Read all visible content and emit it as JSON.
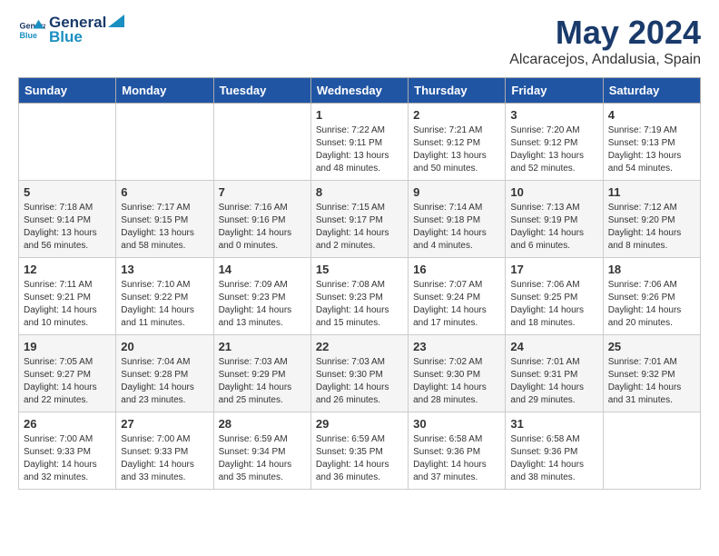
{
  "header": {
    "logo_line1": "General",
    "logo_line2": "Blue",
    "month_title": "May 2024",
    "location": "Alcaracejos, Andalusia, Spain"
  },
  "weekdays": [
    "Sunday",
    "Monday",
    "Tuesday",
    "Wednesday",
    "Thursday",
    "Friday",
    "Saturday"
  ],
  "weeks": [
    [
      {
        "day": "",
        "info": ""
      },
      {
        "day": "",
        "info": ""
      },
      {
        "day": "",
        "info": ""
      },
      {
        "day": "1",
        "info": "Sunrise: 7:22 AM\nSunset: 9:11 PM\nDaylight: 13 hours\nand 48 minutes."
      },
      {
        "day": "2",
        "info": "Sunrise: 7:21 AM\nSunset: 9:12 PM\nDaylight: 13 hours\nand 50 minutes."
      },
      {
        "day": "3",
        "info": "Sunrise: 7:20 AM\nSunset: 9:12 PM\nDaylight: 13 hours\nand 52 minutes."
      },
      {
        "day": "4",
        "info": "Sunrise: 7:19 AM\nSunset: 9:13 PM\nDaylight: 13 hours\nand 54 minutes."
      }
    ],
    [
      {
        "day": "5",
        "info": "Sunrise: 7:18 AM\nSunset: 9:14 PM\nDaylight: 13 hours\nand 56 minutes."
      },
      {
        "day": "6",
        "info": "Sunrise: 7:17 AM\nSunset: 9:15 PM\nDaylight: 13 hours\nand 58 minutes."
      },
      {
        "day": "7",
        "info": "Sunrise: 7:16 AM\nSunset: 9:16 PM\nDaylight: 14 hours\nand 0 minutes."
      },
      {
        "day": "8",
        "info": "Sunrise: 7:15 AM\nSunset: 9:17 PM\nDaylight: 14 hours\nand 2 minutes."
      },
      {
        "day": "9",
        "info": "Sunrise: 7:14 AM\nSunset: 9:18 PM\nDaylight: 14 hours\nand 4 minutes."
      },
      {
        "day": "10",
        "info": "Sunrise: 7:13 AM\nSunset: 9:19 PM\nDaylight: 14 hours\nand 6 minutes."
      },
      {
        "day": "11",
        "info": "Sunrise: 7:12 AM\nSunset: 9:20 PM\nDaylight: 14 hours\nand 8 minutes."
      }
    ],
    [
      {
        "day": "12",
        "info": "Sunrise: 7:11 AM\nSunset: 9:21 PM\nDaylight: 14 hours\nand 10 minutes."
      },
      {
        "day": "13",
        "info": "Sunrise: 7:10 AM\nSunset: 9:22 PM\nDaylight: 14 hours\nand 11 minutes."
      },
      {
        "day": "14",
        "info": "Sunrise: 7:09 AM\nSunset: 9:23 PM\nDaylight: 14 hours\nand 13 minutes."
      },
      {
        "day": "15",
        "info": "Sunrise: 7:08 AM\nSunset: 9:23 PM\nDaylight: 14 hours\nand 15 minutes."
      },
      {
        "day": "16",
        "info": "Sunrise: 7:07 AM\nSunset: 9:24 PM\nDaylight: 14 hours\nand 17 minutes."
      },
      {
        "day": "17",
        "info": "Sunrise: 7:06 AM\nSunset: 9:25 PM\nDaylight: 14 hours\nand 18 minutes."
      },
      {
        "day": "18",
        "info": "Sunrise: 7:06 AM\nSunset: 9:26 PM\nDaylight: 14 hours\nand 20 minutes."
      }
    ],
    [
      {
        "day": "19",
        "info": "Sunrise: 7:05 AM\nSunset: 9:27 PM\nDaylight: 14 hours\nand 22 minutes."
      },
      {
        "day": "20",
        "info": "Sunrise: 7:04 AM\nSunset: 9:28 PM\nDaylight: 14 hours\nand 23 minutes."
      },
      {
        "day": "21",
        "info": "Sunrise: 7:03 AM\nSunset: 9:29 PM\nDaylight: 14 hours\nand 25 minutes."
      },
      {
        "day": "22",
        "info": "Sunrise: 7:03 AM\nSunset: 9:30 PM\nDaylight: 14 hours\nand 26 minutes."
      },
      {
        "day": "23",
        "info": "Sunrise: 7:02 AM\nSunset: 9:30 PM\nDaylight: 14 hours\nand 28 minutes."
      },
      {
        "day": "24",
        "info": "Sunrise: 7:01 AM\nSunset: 9:31 PM\nDaylight: 14 hours\nand 29 minutes."
      },
      {
        "day": "25",
        "info": "Sunrise: 7:01 AM\nSunset: 9:32 PM\nDaylight: 14 hours\nand 31 minutes."
      }
    ],
    [
      {
        "day": "26",
        "info": "Sunrise: 7:00 AM\nSunset: 9:33 PM\nDaylight: 14 hours\nand 32 minutes."
      },
      {
        "day": "27",
        "info": "Sunrise: 7:00 AM\nSunset: 9:33 PM\nDaylight: 14 hours\nand 33 minutes."
      },
      {
        "day": "28",
        "info": "Sunrise: 6:59 AM\nSunset: 9:34 PM\nDaylight: 14 hours\nand 35 minutes."
      },
      {
        "day": "29",
        "info": "Sunrise: 6:59 AM\nSunset: 9:35 PM\nDaylight: 14 hours\nand 36 minutes."
      },
      {
        "day": "30",
        "info": "Sunrise: 6:58 AM\nSunset: 9:36 PM\nDaylight: 14 hours\nand 37 minutes."
      },
      {
        "day": "31",
        "info": "Sunrise: 6:58 AM\nSunset: 9:36 PM\nDaylight: 14 hours\nand 38 minutes."
      },
      {
        "day": "",
        "info": ""
      }
    ]
  ]
}
